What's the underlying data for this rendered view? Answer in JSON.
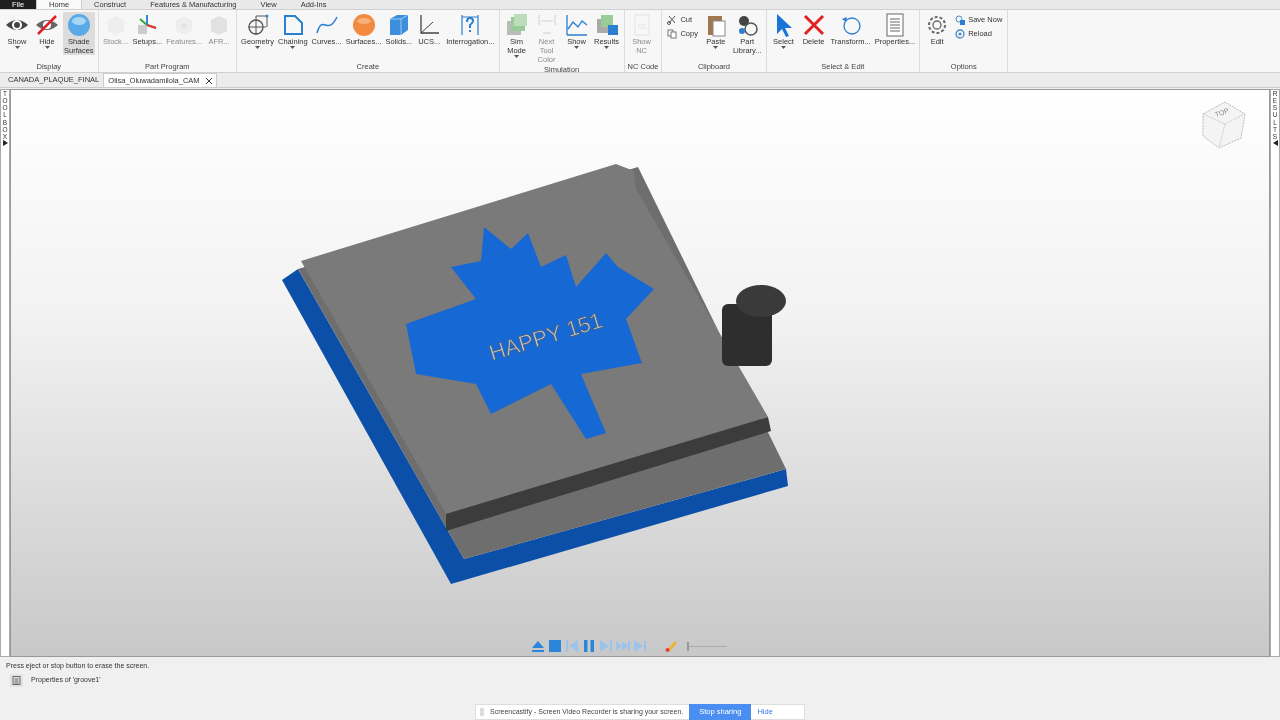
{
  "menu_tabs": [
    {
      "label": "File",
      "kind": "file",
      "selected": false
    },
    {
      "label": "Home",
      "kind": "tab",
      "selected": true
    },
    {
      "label": "Construct",
      "kind": "tab",
      "selected": false
    },
    {
      "label": "Features & Manufacturing",
      "kind": "tab",
      "selected": false
    },
    {
      "label": "View",
      "kind": "tab",
      "selected": false
    },
    {
      "label": "Add-Ins",
      "kind": "tab",
      "selected": false
    }
  ],
  "ribbon_groups": [
    {
      "label": "Display",
      "items": [
        {
          "label": "Show",
          "kind": "large",
          "dropdown": true,
          "disabled": false,
          "on": false
        },
        {
          "label": "Hide",
          "kind": "large",
          "dropdown": true,
          "disabled": false,
          "on": false
        },
        {
          "label": "Shade Surfaces",
          "kind": "large",
          "dropdown": false,
          "disabled": false,
          "on": true
        }
      ]
    },
    {
      "label": "Part Program",
      "items": [
        {
          "label": "Stock...",
          "kind": "large",
          "dropdown": false,
          "disabled": true
        },
        {
          "label": "Setups...",
          "kind": "large",
          "dropdown": false,
          "disabled": false
        },
        {
          "label": "Features...",
          "kind": "large",
          "dropdown": false,
          "disabled": true
        },
        {
          "label": "AFR...",
          "kind": "large",
          "dropdown": false,
          "disabled": true
        }
      ]
    },
    {
      "label": "Create",
      "items": [
        {
          "label": "Geometry",
          "kind": "large",
          "dropdown": true,
          "disabled": false
        },
        {
          "label": "Chaining",
          "kind": "large",
          "dropdown": true,
          "disabled": false
        },
        {
          "label": "Curves...",
          "kind": "large",
          "dropdown": false,
          "disabled": false
        },
        {
          "label": "Surfaces...",
          "kind": "large",
          "dropdown": false,
          "disabled": false
        },
        {
          "label": "Solids...",
          "kind": "large",
          "dropdown": false,
          "disabled": false
        },
        {
          "label": "UCS...",
          "kind": "large",
          "dropdown": false,
          "disabled": false
        },
        {
          "label": "Interrogation...",
          "kind": "large",
          "dropdown": false,
          "disabled": false
        }
      ]
    },
    {
      "label": "Simulation",
      "items": [
        {
          "label": "Sim Mode",
          "kind": "large",
          "dropdown": true,
          "disabled": false
        },
        {
          "label": "Next Tool Color",
          "kind": "large",
          "dropdown": false,
          "disabled": true
        },
        {
          "label": "Show",
          "kind": "large",
          "dropdown": true,
          "disabled": false
        },
        {
          "label": "Results",
          "kind": "large",
          "dropdown": true,
          "disabled": false
        }
      ]
    },
    {
      "label": "NC Code",
      "items": [
        {
          "label": "Show NC",
          "kind": "large",
          "dropdown": false,
          "disabled": true
        }
      ]
    },
    {
      "label": "Clipboard",
      "items": [
        {
          "label": "Cut",
          "kind": "small",
          "disabled": false
        },
        {
          "label": "Copy",
          "kind": "small",
          "disabled": false
        },
        {
          "label": "Paste",
          "kind": "large",
          "dropdown": true,
          "disabled": false
        },
        {
          "label": "Part Library...",
          "kind": "large",
          "dropdown": false,
          "disabled": false
        }
      ]
    },
    {
      "label": "Select & Edit",
      "items": [
        {
          "label": "Select",
          "kind": "large",
          "dropdown": true,
          "disabled": false
        },
        {
          "label": "Delete",
          "kind": "large",
          "dropdown": false,
          "disabled": false
        },
        {
          "label": "Transform...",
          "kind": "large",
          "dropdown": false,
          "disabled": false
        },
        {
          "label": "Properties...",
          "kind": "large",
          "dropdown": false,
          "disabled": false
        }
      ]
    },
    {
      "label": "Options",
      "items": [
        {
          "label": "Edit",
          "kind": "large",
          "dropdown": false,
          "disabled": false
        },
        {
          "label": "Save Now",
          "kind": "small",
          "disabled": false
        },
        {
          "label": "Reload",
          "kind": "small",
          "disabled": false
        }
      ]
    }
  ],
  "doc_tabs": [
    {
      "label": "CANADA_PLAQUE_FINAL",
      "selected": false,
      "closable": false
    },
    {
      "label": "Olisa_Oluwadamilola_CAM",
      "selected": true,
      "closable": true
    }
  ],
  "toolbox": {
    "label": "TOOLBOX"
  },
  "results_panel": {
    "label": "RESULTS"
  },
  "view_cube": {
    "face": "TOP"
  },
  "model": {
    "engraving": "HAPPY 151"
  },
  "player": {
    "buttons": [
      {
        "disabled": false
      },
      {
        "disabled": false
      },
      {
        "disabled": true
      },
      {
        "disabled": false
      },
      {
        "disabled": true
      },
      {
        "disabled": true
      },
      {
        "disabled": true
      }
    ],
    "speed": {
      "level": 0
    }
  },
  "status_text": "Press eject or stop button to erase the screen.",
  "properties_text": "Properties of 'groove1'",
  "share_bar": {
    "message": "Screencastify - Screen Video Recorder is sharing your screen.",
    "stop_button": "Stop sharing",
    "hide_link": "Hide"
  }
}
